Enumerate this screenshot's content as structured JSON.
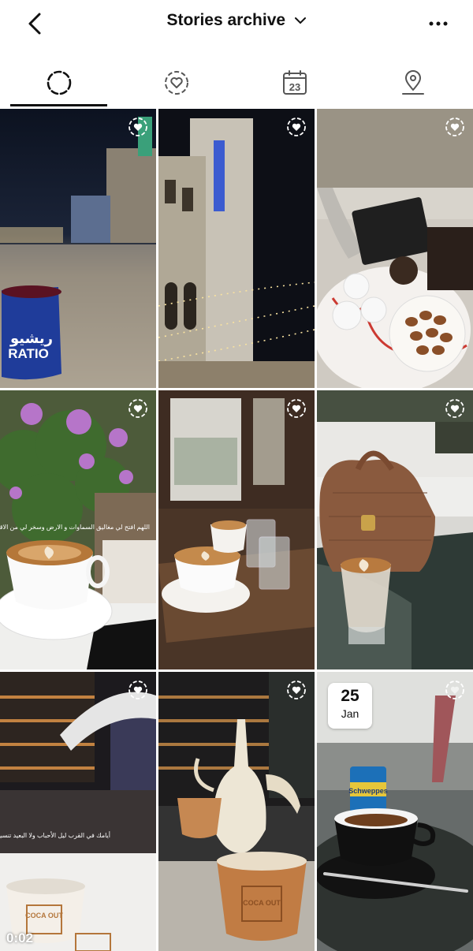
{
  "header": {
    "title": "Stories archive"
  },
  "tabs": [
    {
      "name": "stories",
      "icon": "story-ring-icon",
      "active": true
    },
    {
      "name": "highlights",
      "icon": "heart-ring-icon",
      "active": false
    },
    {
      "name": "calendar",
      "icon": "calendar-icon",
      "calendar_day": "23",
      "active": false
    },
    {
      "name": "map",
      "icon": "location-pin-icon",
      "active": false
    }
  ],
  "tiles": [
    {
      "scene": "night-street-cup",
      "cup_text_ar": "ريشيو",
      "cup_text": "RATIO"
    },
    {
      "scene": "clock-tower-lights"
    },
    {
      "scene": "tray-dates-coffee"
    },
    {
      "scene": "latte-flowers",
      "overlay_text": "اللهم افتح لي مغاليق السماوات و الارض وسخر لي من الاقدار اجملها يارب"
    },
    {
      "scene": "latte-window-tray"
    },
    {
      "scene": "handbag-latte"
    },
    {
      "scene": "night-cup-video",
      "duration": "0:02",
      "overlay_text": "أيامك في القرب ليل الأحباب ولا البعيد تنسيس الجنة جيبتي",
      "cup_brand": "COCA OUT"
    },
    {
      "scene": "dallah-cup",
      "cup_brand": "COCA OUT"
    },
    {
      "scene": "espresso-schweppes",
      "date_day": "25",
      "date_month": "Jan",
      "can_text": "Schweppes"
    }
  ]
}
